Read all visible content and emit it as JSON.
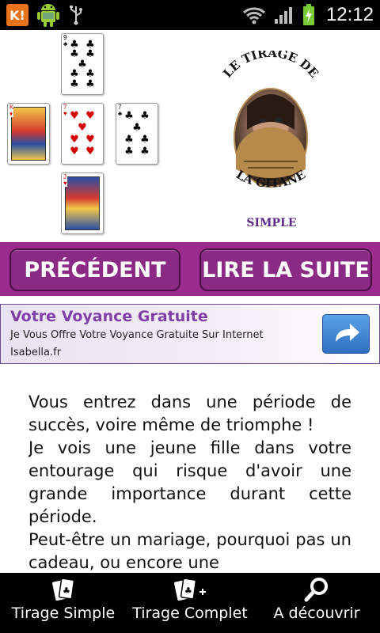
{
  "status_bar": {
    "app_badge": "K!",
    "time": "12:12"
  },
  "logo": {
    "title_line1": "LE TIRAGE DE",
    "title_line2": "LA GITANE",
    "mode": "SIMPLE"
  },
  "buttons": {
    "previous": "PRÉCÉDENT",
    "next": "LIRE LA SUITE"
  },
  "ad": {
    "title": "Votre Voyance Gratuite",
    "text": "Je Vous Offre Votre Voyance Gratuite Sur Internet",
    "domain": "Isabella.fr",
    "colors": {
      "accent": "#7f3fa7",
      "button": "#3b82d6"
    }
  },
  "reading": {
    "paragraphs": [
      "Vous entrez dans une période de succès, voire même de triomphe !",
      "Je vois une jeune fille dans votre entourage qui risque d'avoir une grande importance durant cette période.",
      "Peut-être un mariage, pourquoi pas un cadeau, ou encore une"
    ]
  },
  "bottom_nav": {
    "items": [
      {
        "label": "Tirage Simple",
        "icon": "cards-icon"
      },
      {
        "label": "Tirage Complet",
        "icon": "cards-plus-icon"
      },
      {
        "label": "A découvrir",
        "icon": "search-icon"
      }
    ]
  },
  "colors": {
    "button_bar": "#9b2c8e",
    "button": "#8a2a84"
  }
}
